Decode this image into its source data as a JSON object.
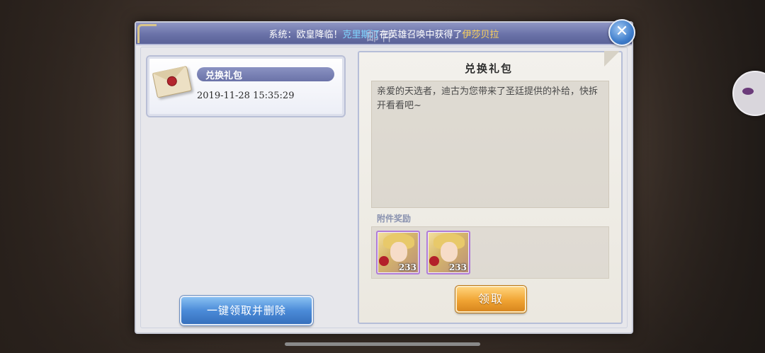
{
  "announcement": {
    "prefix": "系统：欧皇降临！",
    "hero": "克里斯汀",
    "middle": "在英雄召唤中获得了",
    "item": "伊莎贝拉"
  },
  "panel": {
    "title": "邮件",
    "close_icon": "close-icon"
  },
  "mail_list": {
    "items": [
      {
        "icon": "envelope-icon",
        "title": "兑换礼包",
        "date": "2019-11-28  15:35:29"
      }
    ],
    "claim_all_label": "一键领取并删除"
  },
  "detail": {
    "title": "兑换礼包",
    "message": "亲爱的天选者，迪古为您带来了圣廷提供的补给，快拆开看看吧~",
    "rewards_label": "附件奖励",
    "rewards": [
      {
        "icon": "hero-portrait-icon",
        "quantity": "233"
      },
      {
        "icon": "hero-portrait-icon",
        "quantity": "233"
      }
    ],
    "claim_label": "领取"
  },
  "colors": {
    "header": "#6a72a8",
    "hero_name": "#7fd6ff",
    "item_name": "#ffd45a",
    "claim_button": "#f0a433",
    "claim_all_button": "#4b8bd8"
  }
}
